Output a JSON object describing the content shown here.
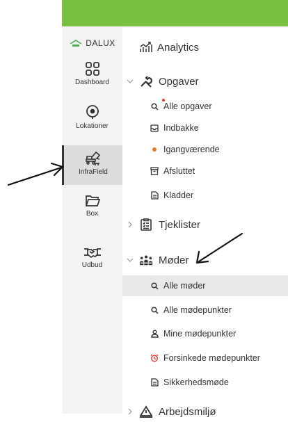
{
  "colors": {
    "topbar": "#7ac143",
    "rail_bg": "#f4f4f4",
    "rail_active": "#dcdcdc",
    "active_row": "#e9e9e9",
    "dot_orange": "#f47920",
    "alarm_red": "#e53935",
    "badge_red": "#e53935",
    "logo_green": "#4caf50"
  },
  "logo": {
    "text": "DALUX",
    "icon": "house-icon"
  },
  "rail": [
    {
      "label": "Dashboard",
      "icon": "grid-icon"
    },
    {
      "label": "Lokationer",
      "icon": "location-pin-icon"
    },
    {
      "label": "InfraField",
      "icon": "excavator-icon",
      "active": true
    },
    {
      "label": "Box",
      "icon": "folder-icon"
    },
    {
      "label": "Udbud",
      "icon": "handshake-icon"
    }
  ],
  "nav": {
    "analytics": {
      "label": "Analytics",
      "icon": "analytics-icon"
    },
    "opgaver": {
      "label": "Opgaver",
      "icon": "wrench-icon",
      "items": [
        {
          "label": "Alle opgaver",
          "icon": "search-icon"
        },
        {
          "label": "Indbakke",
          "icon": "inbox-icon"
        },
        {
          "label": "Igangværende",
          "icon": "dot-icon"
        },
        {
          "label": "Afsluttet",
          "icon": "archive-icon"
        },
        {
          "label": "Kladder",
          "icon": "document-icon"
        }
      ]
    },
    "tjeklister": {
      "label": "Tjeklister",
      "icon": "checklist-icon"
    },
    "moder": {
      "label": "Møder",
      "icon": "people-icon",
      "items": [
        {
          "label": "Alle møder",
          "icon": "search-icon",
          "active": true
        },
        {
          "label": "Alle mødepunkter",
          "icon": "search-icon"
        },
        {
          "label": "Mine mødepunkter",
          "icon": "person-icon"
        },
        {
          "label": "Forsinkede mødepunkter",
          "icon": "alarm-clock-icon"
        },
        {
          "label": "Sikkerhedsmøde",
          "icon": "document-icon"
        }
      ]
    },
    "arbejdsmiljo": {
      "label": "Arbejdsmiljø",
      "icon": "warning-icon"
    }
  }
}
